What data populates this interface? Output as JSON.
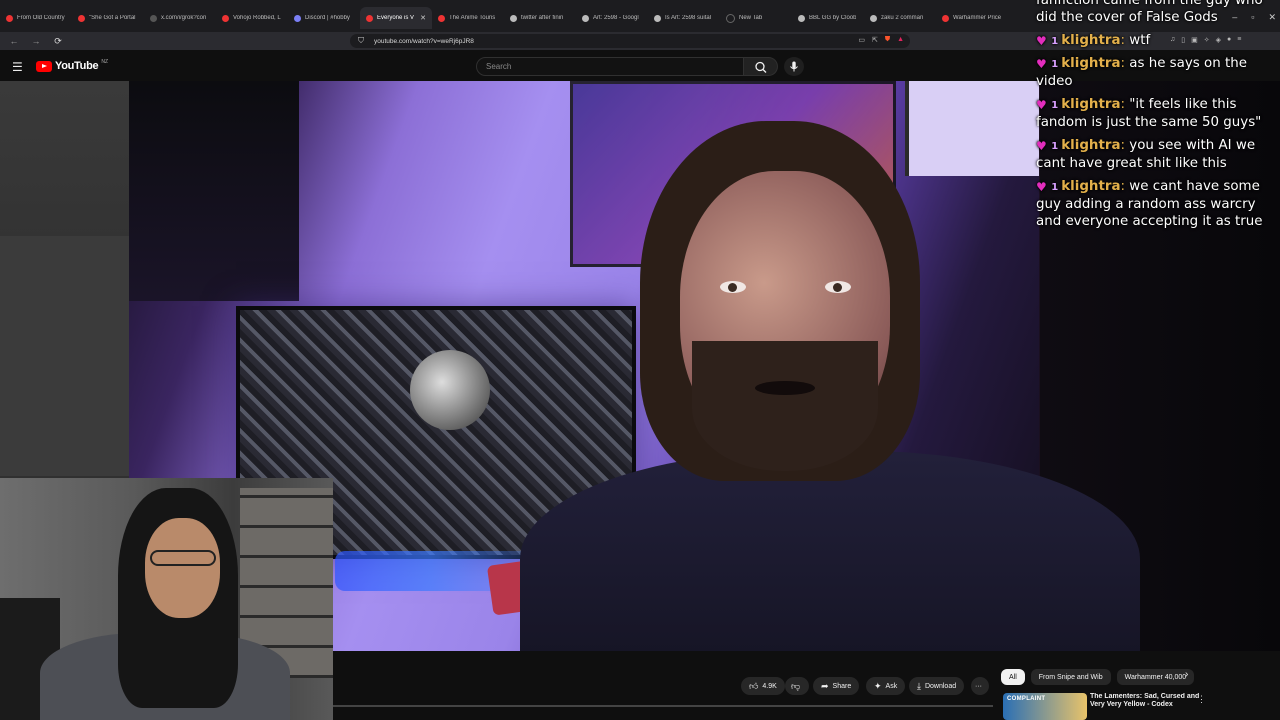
{
  "browser": {
    "tabs": [
      {
        "label": "From Old Country",
        "favicon": "youtube"
      },
      {
        "label": "\"She Got a Portal",
        "favicon": "youtube"
      },
      {
        "label": "x.com/i/grok?con",
        "favicon": "x"
      },
      {
        "label": "Vohojo Robbed, L",
        "favicon": "youtube"
      },
      {
        "label": "Discord | #hobby",
        "favicon": "discord"
      },
      {
        "label": "Everyone is V",
        "favicon": "youtube",
        "active": true
      },
      {
        "label": "The Anime Touris",
        "favicon": "youtube"
      },
      {
        "label": "twitter after finin",
        "favicon": "google"
      },
      {
        "label": "Art: 2598 - Googl",
        "favicon": "google"
      },
      {
        "label": "Is Art: 2598 suital",
        "favicon": "google"
      },
      {
        "label": "New Tab",
        "favicon": "none"
      },
      {
        "label": "BBL GG by Cloob",
        "favicon": "google"
      },
      {
        "label": "zaku 2 comman",
        "favicon": "google"
      },
      {
        "label": "Warhammer Price",
        "favicon": "youtube"
      }
    ],
    "tab_close_glyph": "✕",
    "url": "youtube.com/watch?v=weRj6pJR8",
    "nav": {
      "back": "←",
      "forward": "→",
      "reload": "⟳"
    },
    "window_controls": {
      "minimize": "–",
      "maximize": "▫",
      "close": "✕"
    }
  },
  "youtube": {
    "logo_text": "YouTube",
    "region": "NZ",
    "search_placeholder": "Search",
    "actions": {
      "likes": "4.9K",
      "share": "Share",
      "ask": "Ask",
      "download": "Download",
      "more": "···"
    },
    "chips": [
      "All",
      "From Snipe and Wib",
      "Warhammer 40,000"
    ],
    "selected_chip": "All",
    "recommended": {
      "thumb_label": "COMPLAINT",
      "title": "The Lamenters: Sad, Cursed and Very Very Yellow - Codex"
    }
  },
  "chat": {
    "top_text": "fanfiction came from the guy who did the cover of False Gods",
    "badge_sub_text": "1",
    "messages": [
      {
        "user": "klightra",
        "text": "wtf"
      },
      {
        "user": "klightra",
        "text": "as he says on the video"
      },
      {
        "user": "klightra",
        "text": "\"it feels like this fandom is just the same 50 guys\""
      },
      {
        "user": "klightra",
        "text": "you see with AI we cant have great shit like this"
      },
      {
        "user": "klightra",
        "text": "we cant have some guy adding a random ass warcry and everyone accepting it as true"
      }
    ]
  },
  "colors": {
    "youtube_red": "#ff0000",
    "chat_username": "#e3b04b",
    "chat_badge": "#e32dbd",
    "background": "#0f0f0f"
  }
}
